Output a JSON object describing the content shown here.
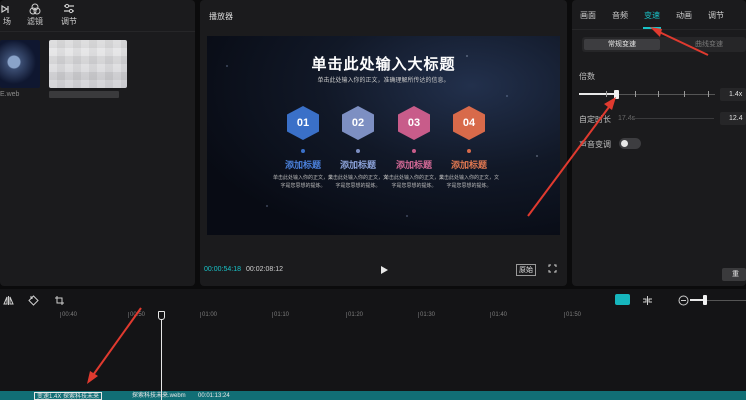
{
  "left_panel": {
    "tabs": [
      {
        "label": "场",
        "icon": "music-icon"
      },
      {
        "label": "滤镜",
        "icon": "filter-icon"
      },
      {
        "label": "调节",
        "icon": "adjust-icon"
      }
    ],
    "media": [
      {
        "label": "E.web"
      }
    ]
  },
  "player": {
    "title": "播放器",
    "current_time": "00:00:54:18",
    "total_time": "00:02:08:12",
    "ratio_label": "原始",
    "video": {
      "title": "单击此处输入大标题",
      "subtitle": "单击此处输入你的正文，准确理解所传达的信息。",
      "items": [
        {
          "number": "01",
          "heading": "添加标题",
          "color": "#3a70c8",
          "text_color": "#4a7fd8",
          "body": "单击此处输入你的正文，文字是您思想的提炼。"
        },
        {
          "number": "02",
          "heading": "添加标题",
          "color": "#7d8fc2",
          "text_color": "#8aa0d6",
          "body": "单击此处输入你的正文，文字是您思想的提炼。"
        },
        {
          "number": "03",
          "heading": "添加标题",
          "color": "#c85c8a",
          "text_color": "#d06894",
          "body": "单击此处输入你的正文，文字是您思想的提炼。"
        },
        {
          "number": "04",
          "heading": "添加标题",
          "color": "#d86a4a",
          "text_color": "#dc7650",
          "body": "单击此处输入你的正文，文字是您思想的提炼。"
        }
      ]
    }
  },
  "right_panel": {
    "tabs": [
      "画面",
      "音频",
      "变速",
      "动画",
      "调节"
    ],
    "active_tab": "变速",
    "segments": {
      "active": "常规变速",
      "inactive": "曲线变速"
    },
    "speed_label": "倍数",
    "speed_value": "1.4x",
    "speed_fraction": 0.27,
    "duration_label": "自定时长",
    "duration_hint": "17.4s",
    "duration_value": "12.4",
    "pitch_label": "声音变调",
    "pitch_enabled": false,
    "reset_label": "重"
  },
  "timeline": {
    "ruler": [
      "00:40",
      "00:50",
      "01:00",
      "01:10",
      "01:20",
      "01:30",
      "01:40",
      "01:50"
    ],
    "clip": {
      "speed_tag": "变速1.4X",
      "name": "探索科技未来",
      "file": "探索科技未来.webm",
      "duration": "00:01:13:24"
    },
    "accent": "#16b6bd"
  },
  "colors": {
    "accent": "#19c3c8",
    "annotation": "#e03a2f"
  }
}
